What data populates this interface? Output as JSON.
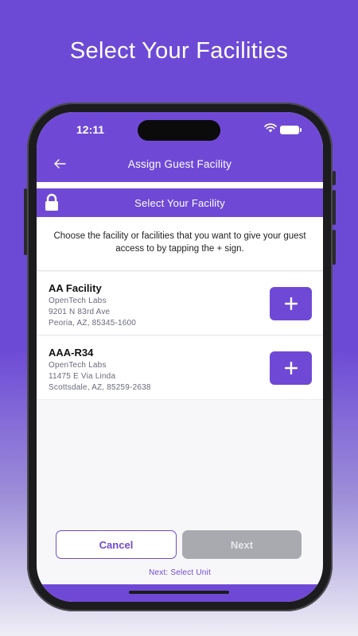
{
  "headline": "Select Your Facilities",
  "status_bar": {
    "time": "12:11"
  },
  "header": {
    "title": "Assign Guest Facility",
    "back_icon": "arrow-left-icon"
  },
  "section": {
    "title": "Select Your Facility",
    "icon": "lock-icon"
  },
  "intro": "Choose the facility or facilities that you want to give your guest access to by tapping the + sign.",
  "facilities": [
    {
      "name": "AA Facility",
      "company": "OpenTech Labs",
      "address": "9201 N 83rd Ave",
      "city": "Peoria, AZ, 85345-1600",
      "add_label": "+"
    },
    {
      "name": "AAA-R34",
      "company": "OpenTech Labs",
      "address": "11475 E Via Linda",
      "city": "Scottsdale, AZ, 85259-2638",
      "add_label": "+"
    }
  ],
  "footer": {
    "cancel_label": "Cancel",
    "next_label": "Next",
    "next_hint": "Next: Select Unit"
  },
  "colors": {
    "primary": "#6f49d6",
    "disabled": "#a9aab0",
    "background": "#f7f7f9"
  }
}
